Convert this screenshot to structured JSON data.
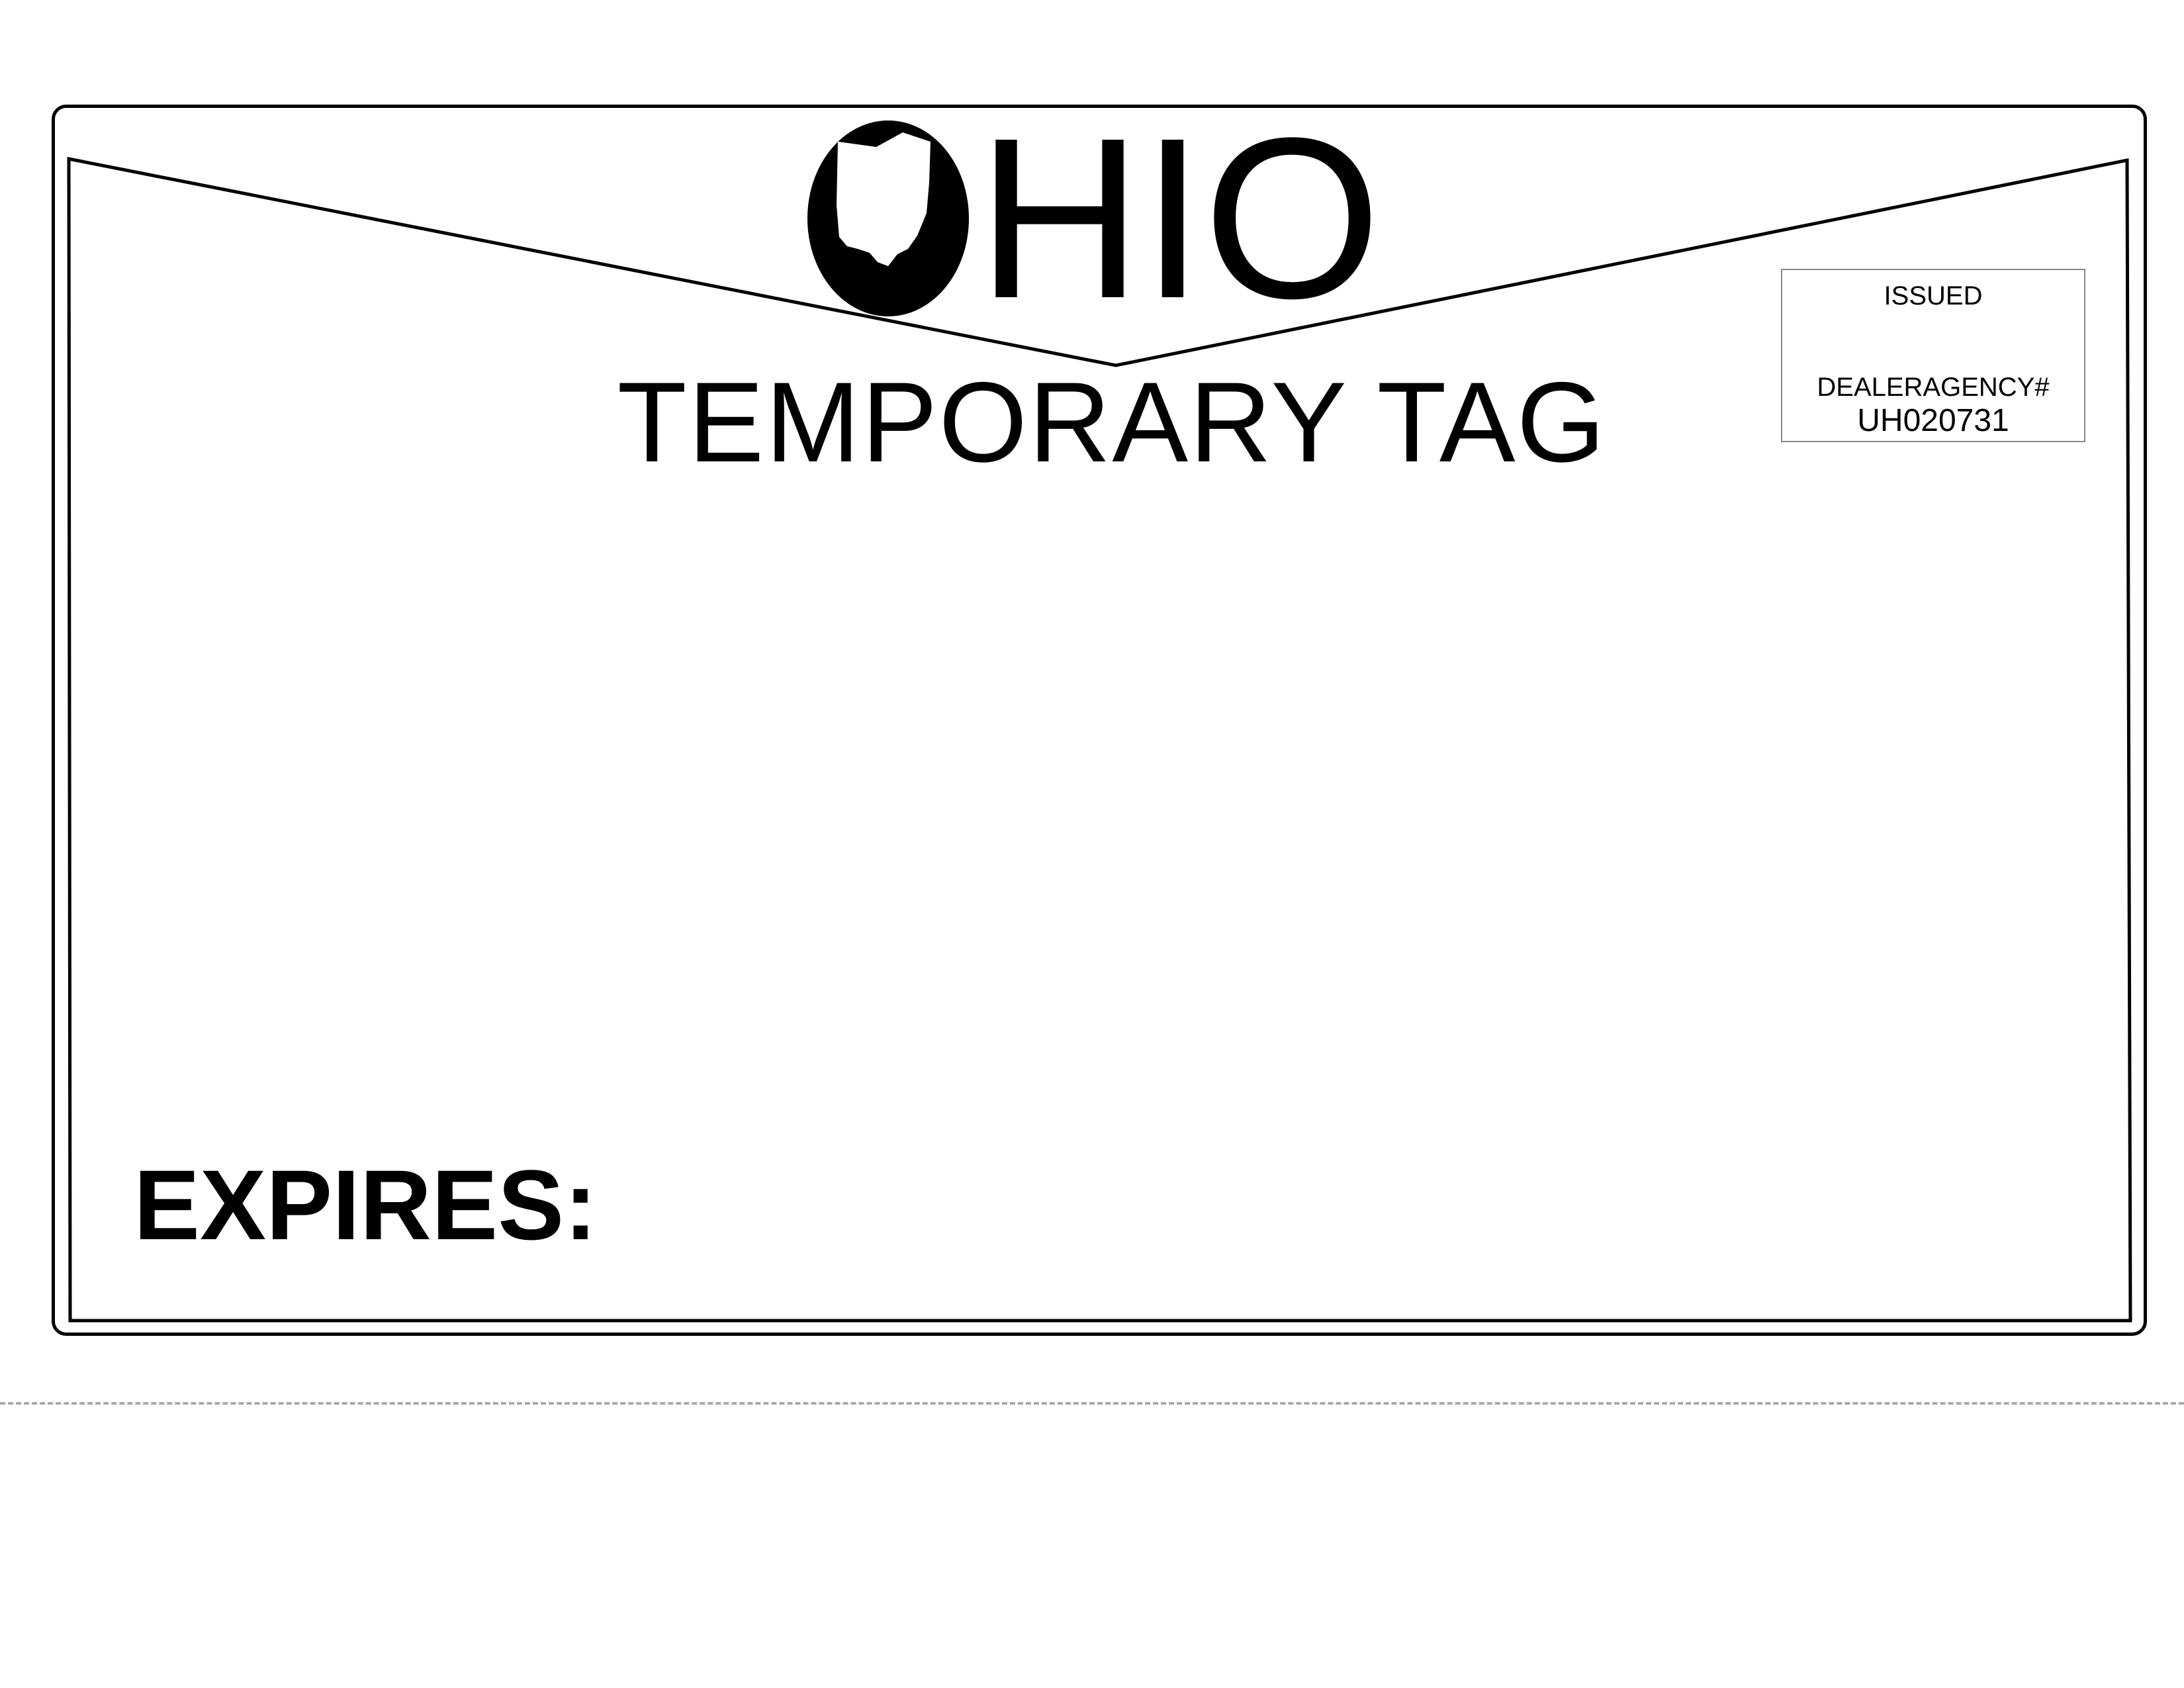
{
  "tag": {
    "state_name_first_letter": "O",
    "state_name_rest": "HIO",
    "type_label": "TEMPORARY TAG",
    "issued_label": "ISSUED",
    "dealer_label": "DEALERAGENCY#",
    "dealer_number": "UH020731",
    "expires_label": "EXPIRES:"
  },
  "icons": {
    "emblem": "ohio-state-outline-icon"
  },
  "colors": {
    "ink": "#000000",
    "paper": "#ffffff",
    "box_border": "#888888",
    "cut_line": "#aaaaaa"
  }
}
